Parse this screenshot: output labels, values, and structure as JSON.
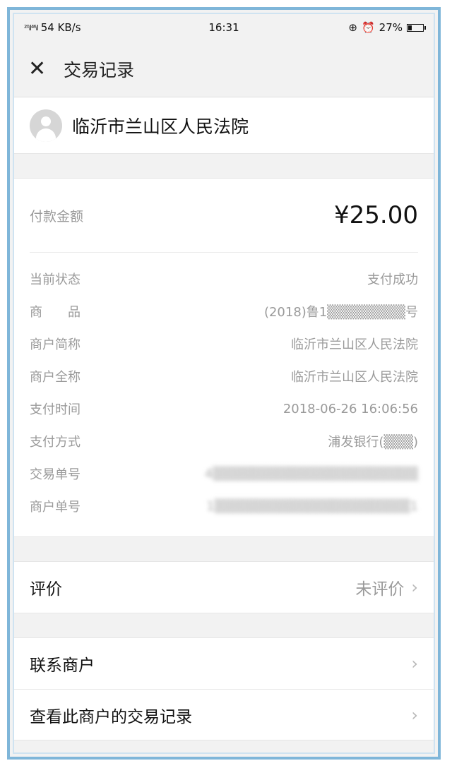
{
  "status_bar": {
    "signal": "²⁰ᵢl⁴⁶ᵢl",
    "speed": "54 KB/s",
    "time": "16:31",
    "battery": "27%",
    "battery_level": 0.27
  },
  "nav": {
    "close_icon": "close-icon",
    "title": "交易记录"
  },
  "merchant": {
    "avatar_icon": "user-avatar-icon",
    "name": "临沂市兰山区人民法院"
  },
  "payment": {
    "amount_label": "付款金额",
    "amount": "¥25.00",
    "details": [
      {
        "label": "当前状态",
        "value": "支付成功"
      },
      {
        "label": "商　　品",
        "value": "(2018)鲁1▒▒▒▒▒▒▒▒号"
      },
      {
        "label": "商户简称",
        "value": "临沂市兰山区人民法院"
      },
      {
        "label": "商户全称",
        "value": "临沂市兰山区人民法院"
      },
      {
        "label": "支付时间",
        "value": "2018-06-26 16:06:56"
      },
      {
        "label": "支付方式",
        "value": "浦发银行(▒▒▒)"
      },
      {
        "label": "交易单号",
        "value": "4▒▒▒▒▒▒▒▒▒▒▒▒▒▒▒▒▒▒▒▒▒"
      },
      {
        "label": "商户单号",
        "value": "1▒▒▒▒▒▒▒▒▒▒▒▒▒▒▒▒▒▒▒▒1"
      }
    ]
  },
  "review": {
    "label": "评价",
    "status": "未评价"
  },
  "actions": {
    "contact": "联系商户",
    "history": "查看此商户的交易记录"
  }
}
